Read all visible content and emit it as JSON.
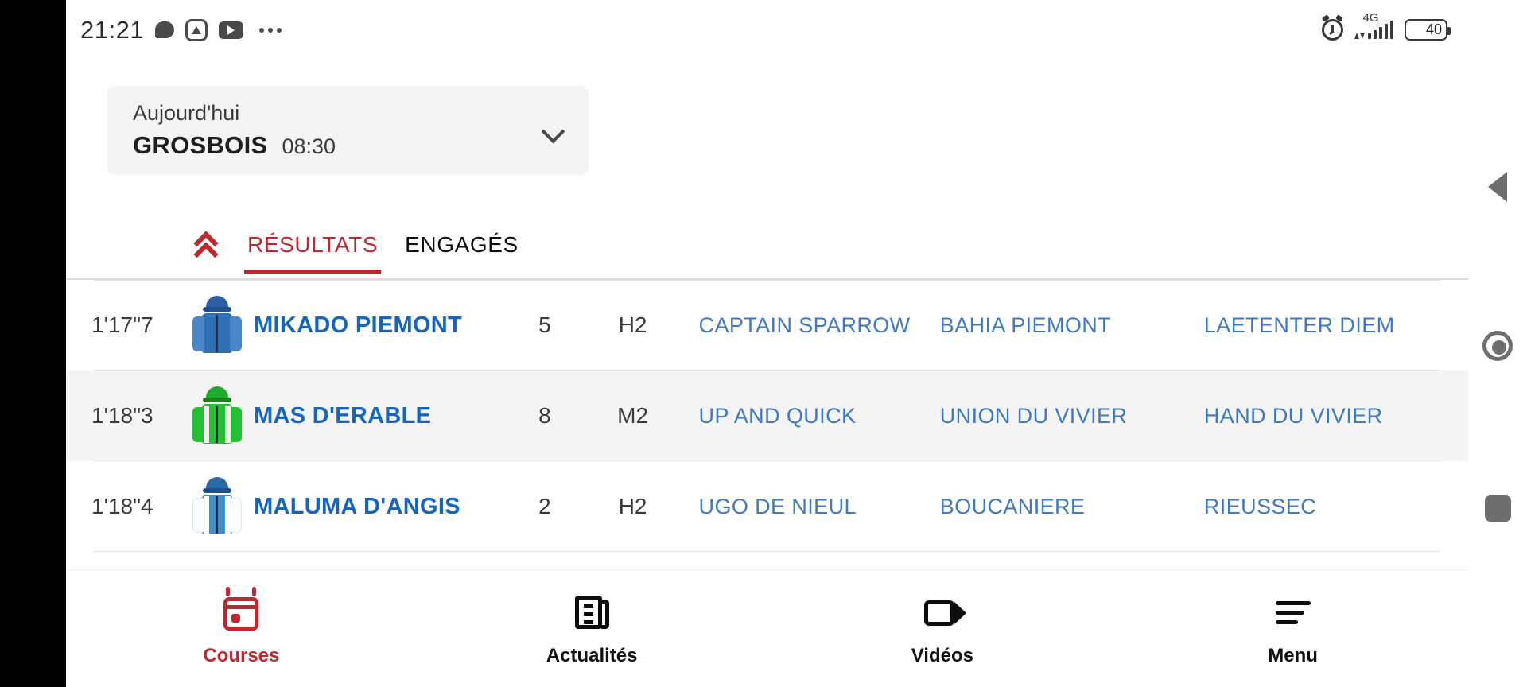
{
  "status_bar": {
    "clock": "21:21",
    "left_icons": [
      "chat-bubble-icon",
      "triangle-badge-icon",
      "youtube-icon",
      "more-dots-icon"
    ],
    "network_type": "4G",
    "battery_level": "40",
    "right_icons": [
      "alarm-icon",
      "signal-bars-icon",
      "battery-icon"
    ]
  },
  "race_card": {
    "day_label": "Aujourd'hui",
    "track": "GROSBOIS",
    "time": "08:30",
    "expand_icon": "chevron-down-icon"
  },
  "tabs": {
    "collapse_icon": "double-chevron-up-icon",
    "items": [
      {
        "label": "RÉSULTATS",
        "active": true
      },
      {
        "label": "ENGAGÉS",
        "active": false
      }
    ]
  },
  "results": {
    "columns": [
      "time",
      "silk",
      "horse",
      "number",
      "category",
      "other1",
      "other2",
      "other3"
    ],
    "rows": [
      {
        "time": "1'17\"7",
        "horse": "MIKADO PIEMONT",
        "number": "5",
        "category": "H2",
        "other1": "CAPTAIN SPARROW",
        "other2": "BAHIA PIEMONT",
        "other3": "LAETENTER DIEM",
        "silk": {
          "body": "#2f6fb5",
          "sleeve": "#4a86c8",
          "cap": "#2a5fa5",
          "stripe": "",
          "style": "solid"
        }
      },
      {
        "time": "1'18\"3",
        "horse": "MAS D'ERABLE",
        "number": "8",
        "category": "M2",
        "other1": "UP AND QUICK",
        "other2": "UNION DU VIVIER",
        "other3": "HAND DU VIVIER",
        "silk": {
          "body": "#22c032",
          "sleeve": "#22c032",
          "cap": "#1faa2c",
          "stripe": "#eef3ec",
          "style": "striped"
        }
      },
      {
        "time": "1'18\"4",
        "horse": "MALUMA D'ANGIS",
        "number": "2",
        "category": "H2",
        "other1": "UGO DE NIEUL",
        "other2": "BOUCANIERE",
        "other3": "RIEUSSEC",
        "silk": {
          "body": "#3f8fc9",
          "sleeve": "#fbfcfd",
          "cap": "#2a6aa8",
          "stripe": "#fbfcfd",
          "style": "panel"
        }
      }
    ]
  },
  "bottom_nav": {
    "items": [
      {
        "label": "Courses",
        "icon": "calendar-icon",
        "active": true
      },
      {
        "label": "Actualités",
        "icon": "newspaper-icon",
        "active": false
      },
      {
        "label": "Vidéos",
        "icon": "video-camera-icon",
        "active": false
      },
      {
        "label": "Menu",
        "icon": "hamburger-icon",
        "active": false
      }
    ]
  },
  "android_nav": {
    "back_icon": "back-triangle-icon",
    "home_icon": "home-circle-icon",
    "recents_icon": "recents-square-icon"
  },
  "colors": {
    "accent_red": "#c1272d",
    "horse_blue": "#1565c0",
    "link_blue": "#3e7ac4",
    "row_alt": "#f4f4f4"
  }
}
